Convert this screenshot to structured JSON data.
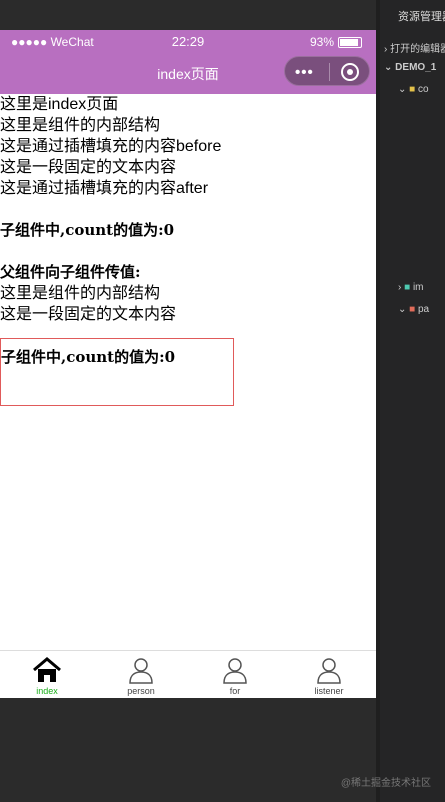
{
  "statusbar": {
    "signal": "●●●●● WeChat",
    "time": "22:29",
    "battery": "93%"
  },
  "navbar": {
    "title": "index页面",
    "colors": {
      "navbar_bg": "#b86fc0"
    }
  },
  "content": {
    "lines": [
      "这里是index页面",
      "这里是组件的内部结构",
      "这是通过插槽填充的内容before",
      "这是一段固定的文本内容",
      "这是通过插槽填充的内容after"
    ],
    "child_count_1": "子组件中,count的值为:0",
    "parent_pass": "父组件向子组件传值:",
    "lines2": [
      "这里是组件的内部结构",
      "这是一段固定的文本内容"
    ],
    "child_count_2": "子组件中,count的值为:0"
  },
  "tabbar": {
    "tabs": [
      {
        "label": "index",
        "icon": "home-icon"
      },
      {
        "label": "person",
        "icon": "person-icon"
      },
      {
        "label": "for",
        "icon": "person-icon"
      },
      {
        "label": "listener",
        "icon": "person-icon"
      }
    ],
    "active_color": "#1aad19"
  },
  "sidebar": {
    "title": "资源管理器",
    "open_editors": "打开的编辑器",
    "project": "DEMO_1",
    "rows": [
      "co",
      "im",
      "pa"
    ]
  },
  "watermark": "@稀土掘金技术社区"
}
